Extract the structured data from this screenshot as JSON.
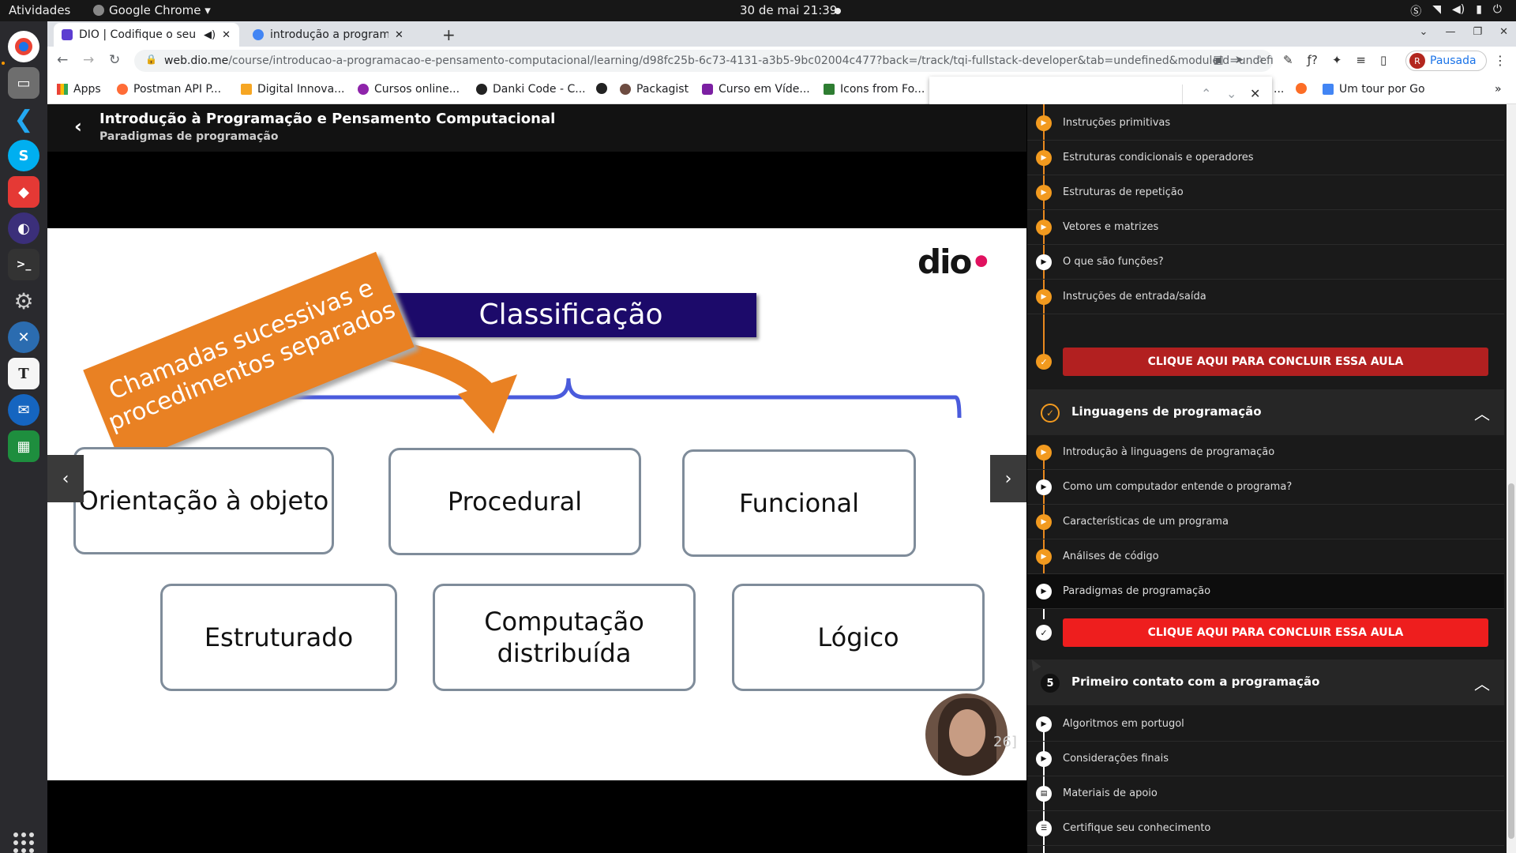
{
  "os": {
    "activities": "Atividades",
    "app_name": "Google Chrome ▾",
    "clock": "30 de mai  21:39",
    "tray": [
      "S",
      "wifi",
      "vol",
      "bat",
      "⏻▾"
    ]
  },
  "browser": {
    "tabs": [
      {
        "title": "DIO | Codifique o seu f",
        "active": true
      },
      {
        "title": "introdução a programaçã",
        "active": false
      }
    ],
    "url_host": "web.dio.me",
    "url_path": "/course/introducao-a-programacao-e-pensamento-computacional/learning/d98fc25b-6c73-4131-a3b5-9bc02004c477?back=/track/tqi-fullstack-developer&tab=undefined&moduleId=undefined",
    "profile_initial": "R",
    "profile_label": "Pausada",
    "bookmarks": [
      {
        "label": "Apps",
        "color": "#ea4335"
      },
      {
        "label": "Postman API P...",
        "color": "#ff6c37"
      },
      {
        "label": "Digital Innova...",
        "color": "#f6a623"
      },
      {
        "label": "Cursos online...",
        "color": "#8e24aa"
      },
      {
        "label": "Danki Code - C...",
        "color": "#222222"
      },
      {
        "label": "",
        "color": "#222222"
      },
      {
        "label": "Packagist",
        "color": "#6d4c41"
      },
      {
        "label": "Curso em Víde...",
        "color": "#7b1fa2"
      },
      {
        "label": "Icons from Fo...",
        "color": "#2e7d32"
      },
      {
        "label": "...",
        "color": "#ffffff"
      },
      {
        "label": "",
        "color": "#fc6d26"
      },
      {
        "label": "Um tour por Go",
        "color": "#4285f4"
      }
    ],
    "more_bookmarks": "»"
  },
  "course": {
    "title": "Introdução à Programação e Pensamento Computacional",
    "subtitle": "Paradigmas de programação"
  },
  "slide": {
    "logo": "dio",
    "heading": "Classificação",
    "callout": "Chamadas sucessivas e procedimentos separados",
    "boxes": [
      "Orientação à objeto",
      "Procedural",
      "Funcional",
      "Estruturado",
      "Computação distribuída",
      "Lógico"
    ],
    "page_hint": "26]"
  },
  "sidebar": {
    "module_a_lessons": [
      {
        "title": "Instruções primitivas",
        "state": "orange"
      },
      {
        "title": "Estruturas condicionais e operadores",
        "state": "orange"
      },
      {
        "title": "Estruturas de repetição",
        "state": "orange"
      },
      {
        "title": "Vetores e matrizes",
        "state": "orange"
      },
      {
        "title": "O que são funções?",
        "state": "white"
      },
      {
        "title": "Instruções de entrada/saída",
        "state": "orange"
      }
    ],
    "cta_label": "CLIQUE AQUI PARA CONCLUIR ESSA AULA",
    "module_b": {
      "title": "Linguagens de programação",
      "lessons": [
        {
          "title": "Introdução à linguagens de programação",
          "state": "orange"
        },
        {
          "title": "Como um computador entende o programa?",
          "state": "white"
        },
        {
          "title": "Características de um programa",
          "state": "orange"
        },
        {
          "title": "Análises de código",
          "state": "orange"
        },
        {
          "title": "Paradigmas de programação",
          "state": "white"
        }
      ]
    },
    "module_c": {
      "number": "5",
      "title": "Primeiro contato com a programação",
      "lessons": [
        {
          "title": "Algoritmos em portugol",
          "icon": "▶"
        },
        {
          "title": "Considerações finais",
          "icon": "▶"
        },
        {
          "title": "Materiais de apoio",
          "icon": "▤"
        },
        {
          "title": "Certifique seu conhecimento",
          "icon": "☰"
        }
      ]
    }
  },
  "colors": {
    "accent_orange": "#f29a1f",
    "cta_red": "#ee1e1e",
    "slide_heading_bg": "#1c0a6a",
    "callout_orange": "#e98123"
  }
}
